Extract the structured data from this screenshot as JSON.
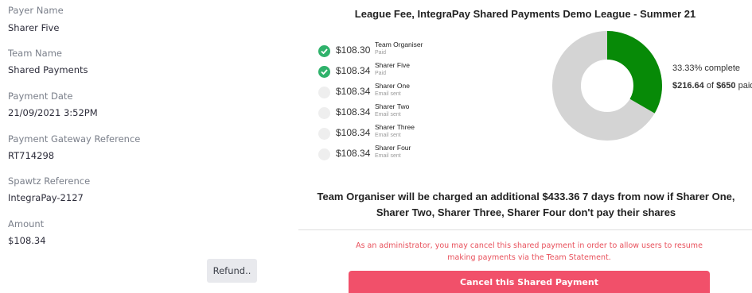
{
  "details": {
    "fields": [
      {
        "label": "Payer Name",
        "value": "Sharer Five"
      },
      {
        "label": "Team Name",
        "value": "Shared Payments"
      },
      {
        "label": "Payment Date",
        "value": "21/09/2021 3:52PM"
      },
      {
        "label": "Payment Gateway Reference",
        "value": "RT714298"
      },
      {
        "label": "Spawtz Reference",
        "value": "IntegraPay-2127"
      },
      {
        "label": "Amount",
        "value": "$108.34"
      }
    ],
    "refund_label": "Refund.."
  },
  "shared_payment": {
    "title": "League Fee, IntegraPay Shared Payments Demo League - Summer 21",
    "shares": [
      {
        "amount": "$108.30",
        "name": "Team Organiser",
        "status": "Paid",
        "paid": true
      },
      {
        "amount": "$108.34",
        "name": "Sharer Five",
        "status": "Paid",
        "paid": true
      },
      {
        "amount": "$108.34",
        "name": "Sharer One",
        "status": "Email sent",
        "paid": false
      },
      {
        "amount": "$108.34",
        "name": "Sharer Two",
        "status": "Email sent",
        "paid": false
      },
      {
        "amount": "$108.34",
        "name": "Sharer Three",
        "status": "Email sent",
        "paid": false
      },
      {
        "amount": "$108.34",
        "name": "Sharer Four",
        "status": "Email sent",
        "paid": false
      }
    ],
    "progress_fraction": 0.3333,
    "percent_text": "33.33% complete",
    "paid_amount": "$216.64",
    "paid_of": " of ",
    "total_amount": "$650",
    "paid_suffix": " paid.",
    "colors": {
      "paid": "#078a07",
      "unpaid": "#d4d4d4",
      "check": "#2fb26b",
      "danger": "#f1506a"
    },
    "warning": "Team Organiser will be charged an additional $433.36 7 days from now if Sharer One, Sharer Two, Sharer Three, Sharer Four don't pay their shares",
    "admin_note": "As an administrator, you may cancel this shared payment in order to allow users to resume making payments via the Team Statement.",
    "cancel_label": "Cancel this Shared Payment"
  }
}
